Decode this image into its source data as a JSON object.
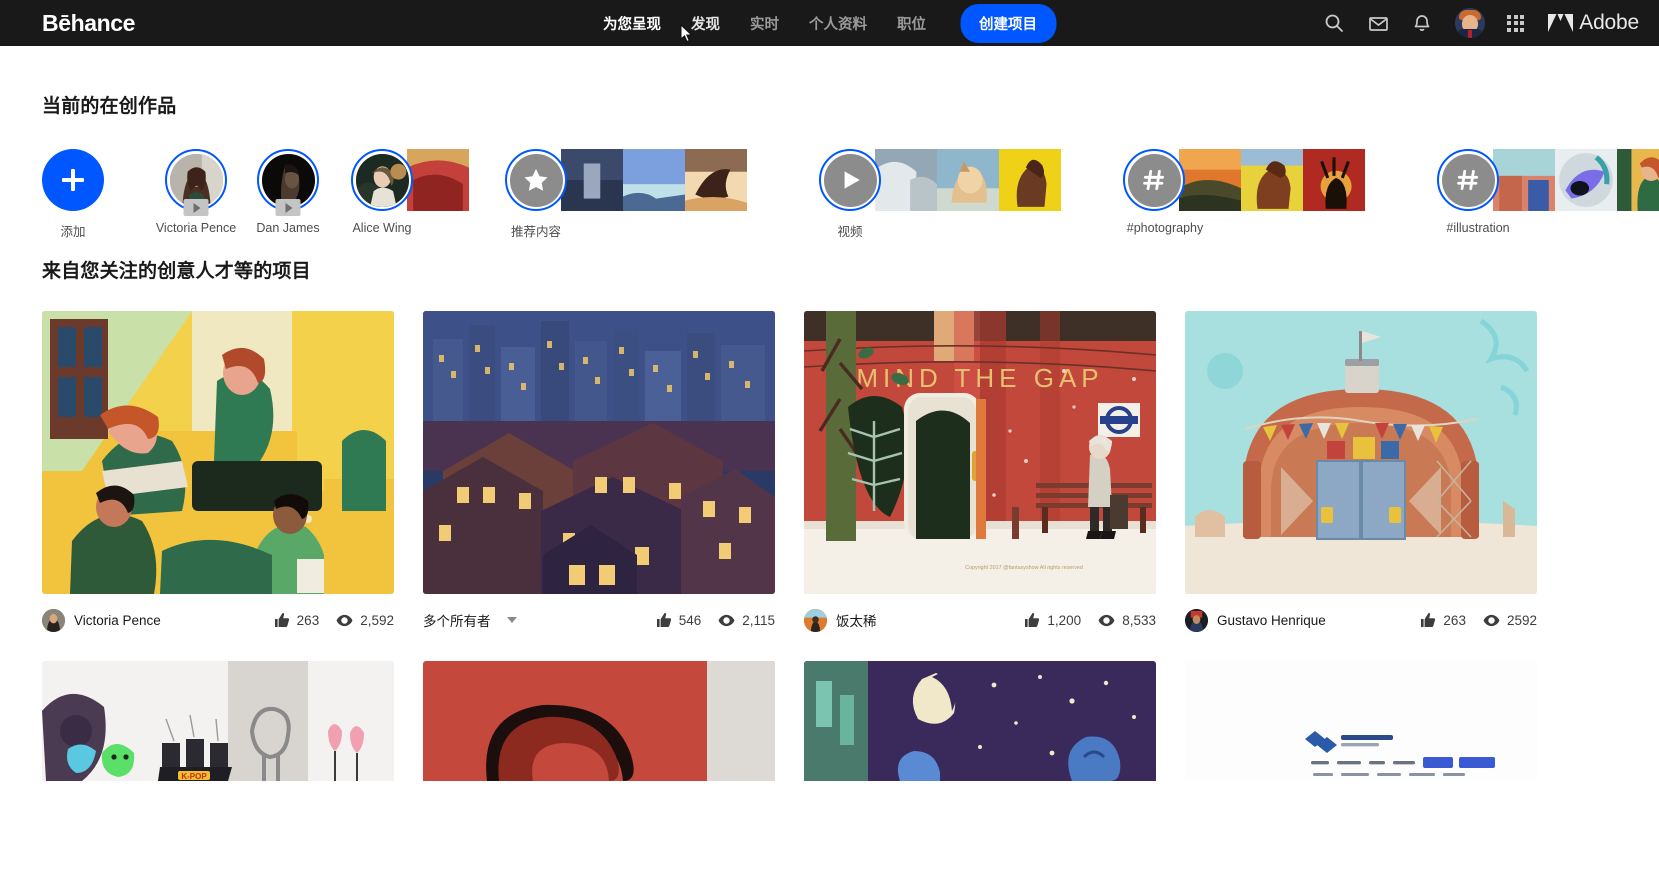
{
  "brand": {
    "logo_text": "Bēhance",
    "adobe_text": "Adobe",
    "accent_blue": "#0057ff",
    "nav_bg": "#191919"
  },
  "nav": {
    "items": [
      {
        "label": "为您呈现",
        "state": "active"
      },
      {
        "label": "发现",
        "state": "hovered"
      },
      {
        "label": "实时",
        "state": "default"
      },
      {
        "label": "个人资料",
        "state": "default"
      },
      {
        "label": "职位",
        "state": "default"
      }
    ],
    "create_button": "创建项目",
    "icons": [
      "search-icon",
      "mail-icon",
      "bell-icon",
      "avatar",
      "app-grid-icon",
      "adobe-logo"
    ]
  },
  "stories_section": {
    "title": "当前的在创作品",
    "items": [
      {
        "label": "添加",
        "kind": "add"
      },
      {
        "label": "Victoria Pence",
        "kind": "avatar",
        "has_play_badge": true
      },
      {
        "label": "Dan James",
        "kind": "avatar",
        "has_play_badge": true
      },
      {
        "label": "Alice Wing",
        "kind": "avatar",
        "has_play_badge": false
      },
      {
        "label": "推荐内容",
        "kind": "star"
      },
      {
        "label": "视频",
        "kind": "play"
      },
      {
        "label": "#photography",
        "kind": "hash"
      },
      {
        "label": "#illustration",
        "kind": "hash"
      }
    ]
  },
  "projects_section": {
    "title": "来自您关注的创意人才等的项目",
    "cards": [
      {
        "owner": "Victoria Pence",
        "owner_type": "single",
        "likes": "263",
        "views": "2,592",
        "artwork": "people-on-bench-illustration"
      },
      {
        "owner": "多个所有者",
        "owner_type": "multiple",
        "likes": "546",
        "views": "2,115",
        "artwork": "blue-city-night-illustration"
      },
      {
        "owner": "饭太稀",
        "owner_type": "single",
        "likes": "1,200",
        "views": "8,533",
        "artwork": "mind-the-gap-illustration",
        "artwork_text": "MIND THE GAP",
        "artwork_copyright": "Copyright 2017 @fantasyshow All rights reserved"
      },
      {
        "owner": "Gustavo Henrique",
        "owner_type": "single",
        "likes": "263",
        "views": "2592",
        "artwork": "3d-building-illustration"
      }
    ],
    "second_row": [
      {
        "artwork": "kpop-collage"
      },
      {
        "artwork": "red-abstract"
      },
      {
        "artwork": "night-moon-illustration"
      },
      {
        "artwork": "website-mockup"
      }
    ]
  }
}
